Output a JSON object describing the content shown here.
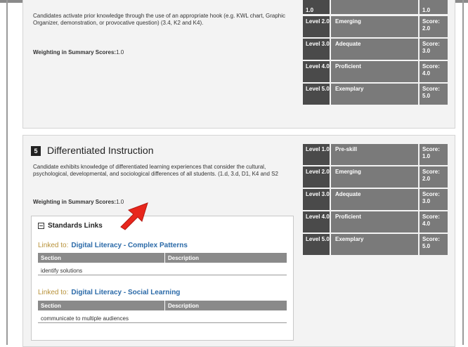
{
  "item4": {
    "description": "Candidates activate prior knowledge through the use of an appropriate hook (e.g. KWL chart, Graphic Organizer, demonstration, or provocative question) (3.4, K2 and K4).",
    "weighting_label": "Weighting in Summary Scores:",
    "weighting_value": "1.0",
    "rubric": [
      {
        "level": "Level 2.0",
        "name": "Emerging",
        "score": "Score: 2.0"
      },
      {
        "level": "Level 3.0",
        "name": "Adequate",
        "score": "Score: 3.0"
      },
      {
        "level": "Level 4.0",
        "name": "Proficient",
        "score": "Score: 4.0"
      },
      {
        "level": "Level 5.0",
        "name": "Exemplary",
        "score": "Score: 5.0"
      }
    ],
    "partial_top_left": "1.0",
    "partial_top_right": "1.0"
  },
  "item5": {
    "number": "5",
    "title": "Differentiated Instruction",
    "description": "Candidate exhibits knowledge of differentiated learning experiences that consider the cultural, psychological, developmental, and sociological differences of all students. (1.d, 3.d, D1, K4 and S2",
    "weighting_label": "Weighting in Summary Scores:",
    "weighting_value": "1.0",
    "rubric": [
      {
        "level": "Level 1.0",
        "name": "Pre-skill",
        "score": "Score: 1.0"
      },
      {
        "level": "Level 2.0",
        "name": "Emerging",
        "score": "Score: 2.0"
      },
      {
        "level": "Level 3.0",
        "name": "Adequate",
        "score": "Score: 3.0"
      },
      {
        "level": "Level 4.0",
        "name": "Proficient",
        "score": "Score: 4.0"
      },
      {
        "level": "Level 5.0",
        "name": "Exemplary",
        "score": "Score: 5.0"
      }
    ]
  },
  "standards": {
    "heading": "Standards Links",
    "linked_prefix": "Linked to:",
    "col_section": "Section",
    "col_description": "Description",
    "links": [
      {
        "name": "Digital Literacy - Complex Patterns",
        "row": "identify solutions"
      },
      {
        "name": "Digital Literacy - Social Learning",
        "row": "communicate to multiple audiences"
      }
    ]
  },
  "colors": {
    "level_cell": "#4a4a4a",
    "rubric_cell": "#7a7a7a",
    "link": "#2b6aa8",
    "linked_prefix": "#b8923a",
    "arrow": "#e8261c"
  },
  "icons": [
    "collapse-minus-icon",
    "red-arrow-pointer"
  ]
}
